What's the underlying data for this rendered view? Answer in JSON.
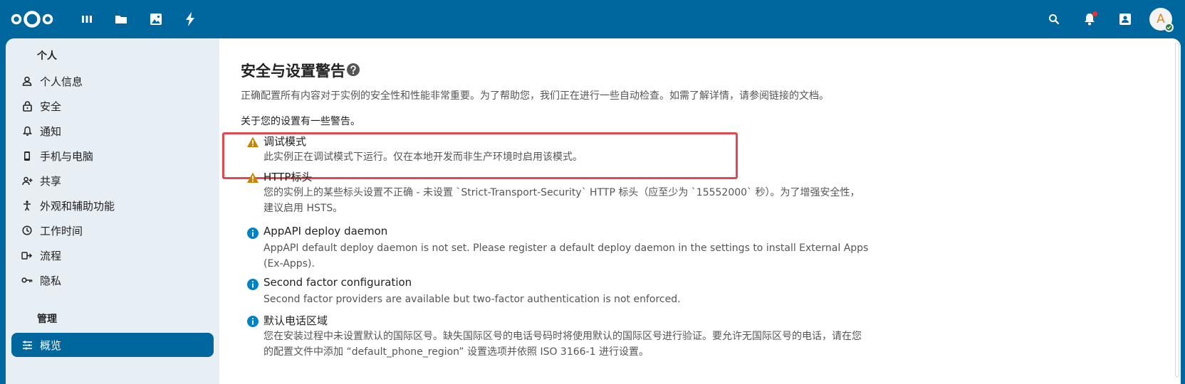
{
  "colors": {
    "header": "#00679e",
    "accent": "#00679e",
    "warning": "#c68400",
    "info": "#0082c9",
    "highlight": "#e1484f"
  },
  "header": {
    "apps": [
      {
        "name": "dashboard",
        "icon": "dashboard-icon"
      },
      {
        "name": "files",
        "icon": "folder-icon"
      },
      {
        "name": "photos",
        "icon": "image-icon"
      },
      {
        "name": "activity",
        "icon": "lightning-icon"
      }
    ],
    "right_icons": [
      "search-icon",
      "bell-icon",
      "contacts-icon"
    ],
    "avatar_letter": "A"
  },
  "sidebar": {
    "personal_title": "个人",
    "personal_items": [
      {
        "label": "个人信息",
        "icon": "user-icon"
      },
      {
        "label": "安全",
        "icon": "lock-icon"
      },
      {
        "label": "通知",
        "icon": "bell-icon"
      },
      {
        "label": "手机与电脑",
        "icon": "phone-icon"
      },
      {
        "label": "共享",
        "icon": "share-icon"
      },
      {
        "label": "外观和辅助功能",
        "icon": "accessibility-icon"
      },
      {
        "label": "工作时间",
        "icon": "clock-icon"
      },
      {
        "label": "流程",
        "icon": "flow-icon"
      },
      {
        "label": "隐私",
        "icon": "key-icon"
      }
    ],
    "admin_title": "管理",
    "admin_items": [
      {
        "label": "概览",
        "icon": "sliders-icon",
        "active": true
      }
    ]
  },
  "main": {
    "title": "安全与设置警告",
    "description": "正确配置所有内容对于实例的安全性和性能非常重要。为了帮助您，我们正在进行一些自动检查。如需了解详情，请参阅链接的文档。",
    "warnings_intro": "关于您的设置有一些警告。",
    "checks": [
      {
        "type": "warning",
        "title": "调试模式",
        "desc": "此实例正在调试模式下运行。仅在本地开发而非生产环境时启用该模式。"
      },
      {
        "type": "warning",
        "title": "HTTP标头",
        "desc": "您的实例上的某些标头设置不正确 - 未设置 `Strict-Transport-Security` HTTP 标头（应至少为 `15552000` 秒）。为了增强安全性，建议启用 HSTS。"
      },
      {
        "type": "info",
        "title": "AppAPI deploy daemon",
        "desc": "AppAPI default deploy daemon is not set. Please register a default deploy daemon in the settings to install External Apps (Ex-Apps)."
      },
      {
        "type": "info",
        "title": "Second factor configuration",
        "desc": "Second factor providers are available but two-factor authentication is not enforced."
      },
      {
        "type": "info",
        "title": "默认电话区域",
        "desc": "您在安装过程中未设置默认的国际区号。缺失国际区号的电话号码时将使用默认的国际区号进行验证。要允许无国际区号的电话，请在您的配置文件中添加 “default_phone_region” 设置选项并依照 ISO 3166-1 进行设置。"
      }
    ]
  }
}
